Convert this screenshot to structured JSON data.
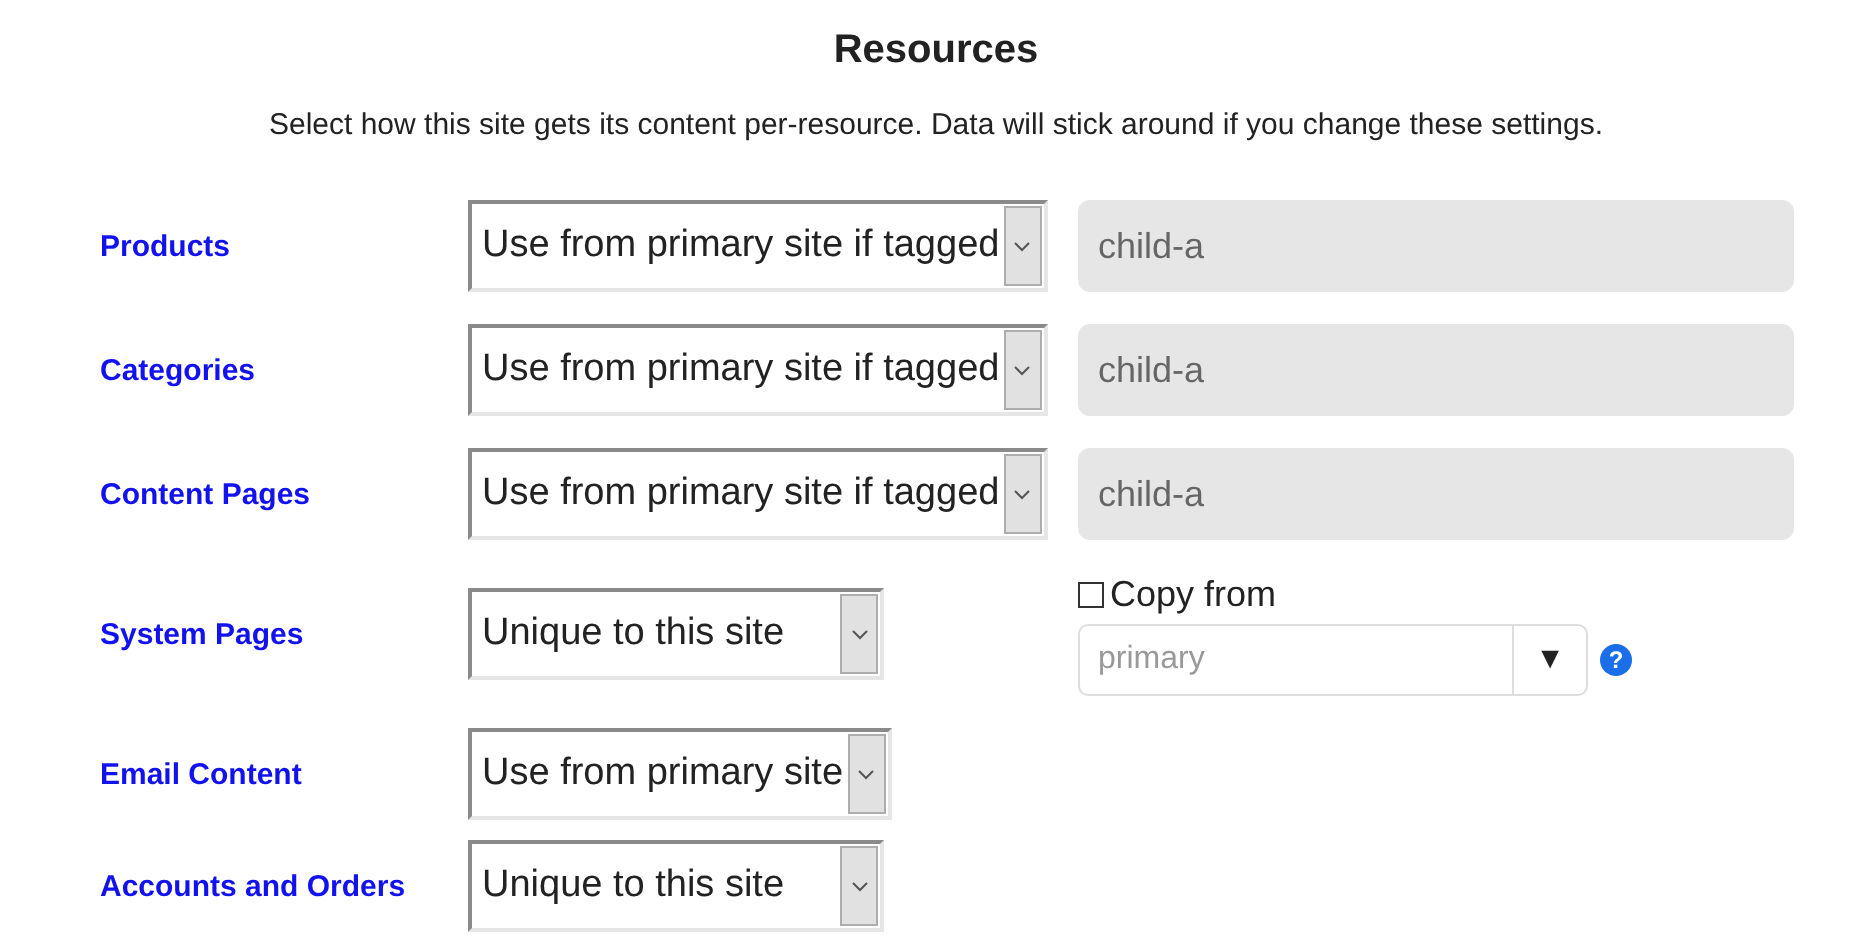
{
  "title": "Resources",
  "description": "Select how this site gets its content per-resource. Data will stick around if you change these settings.",
  "rows": [
    {
      "label": "Products",
      "source": "Use from primary site if tagged",
      "extra": {
        "kind": "field",
        "value": "child-a"
      }
    },
    {
      "label": "Categories",
      "source": "Use from primary site if tagged",
      "extra": {
        "kind": "field",
        "value": "child-a"
      }
    },
    {
      "label": "Content Pages",
      "source": "Use from primary site if tagged",
      "extra": {
        "kind": "field",
        "value": "child-a"
      }
    },
    {
      "label": "System Pages",
      "source": "Unique to this site",
      "extra": {
        "kind": "copy",
        "label": "Copy from",
        "checked": false,
        "placeholder": "primary",
        "arrow": "▼",
        "help": "?"
      }
    },
    {
      "label": "Email Content",
      "source": "Use from primary site"
    },
    {
      "label": "Accounts and Orders",
      "source": "Unique to this site"
    }
  ]
}
